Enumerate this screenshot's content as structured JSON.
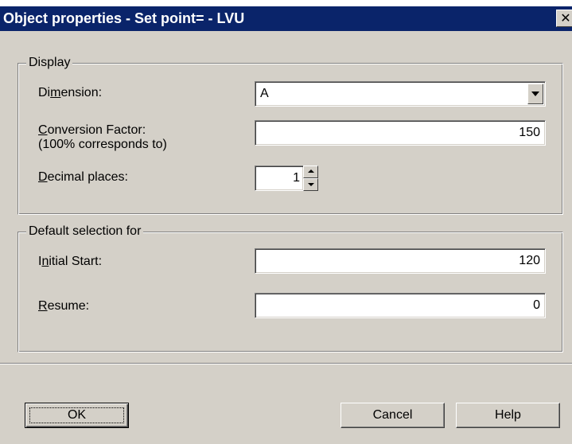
{
  "dialog": {
    "title": "Object properties - Set point= - LVU",
    "close_glyph": "✕"
  },
  "display_group": {
    "legend": "Display",
    "dimension": {
      "label_pre": "Di",
      "label_mnemonic": "m",
      "label_post": "ension:",
      "value": "A"
    },
    "conversion_factor": {
      "label_mnemonic": "C",
      "label_post": "onversion Factor:",
      "label_line2": "(100% corresponds to)",
      "value": "150"
    },
    "decimal_places": {
      "label_mnemonic": "D",
      "label_post": "ecimal places:",
      "value": "1"
    }
  },
  "default_group": {
    "legend": "Default selection for",
    "initial_start": {
      "label_pre": "I",
      "label_mnemonic": "n",
      "label_post": "itial Start:",
      "value": "120"
    },
    "resume": {
      "label_mnemonic": "R",
      "label_post": "esume:",
      "value": "0"
    }
  },
  "buttons": {
    "ok": "OK",
    "cancel": "Cancel",
    "help": "Help"
  }
}
